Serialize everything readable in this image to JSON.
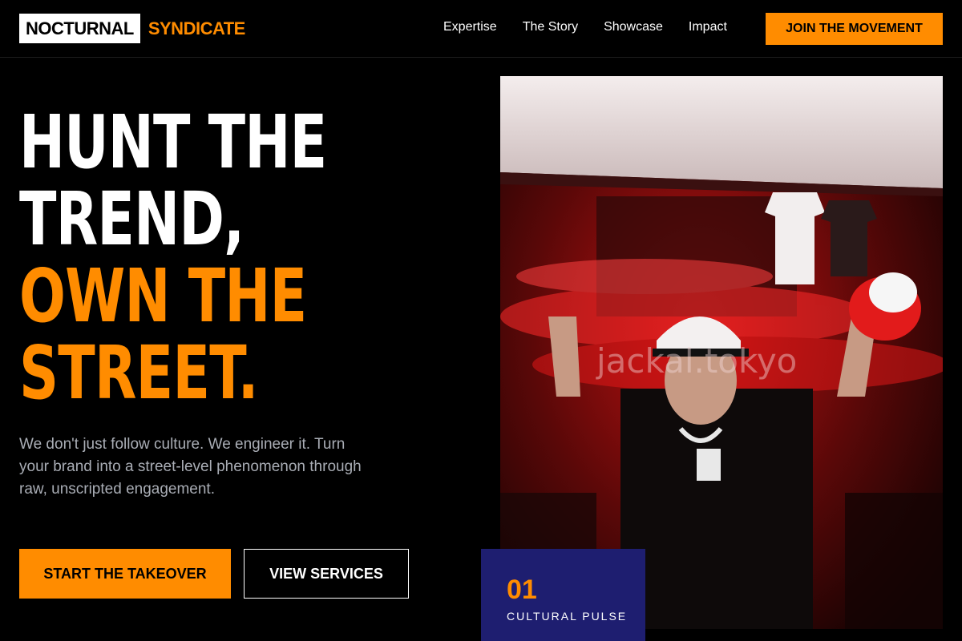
{
  "header": {
    "logo_primary": "NOCTURNAL",
    "logo_accent": "SYNDICATE",
    "nav": [
      {
        "label": "Expertise"
      },
      {
        "label": "The Story"
      },
      {
        "label": "Showcase"
      },
      {
        "label": "Impact"
      }
    ],
    "cta_label": "JOIN THE MOVEMENT"
  },
  "hero": {
    "headline": {
      "line1": "HUNT THE",
      "line2": "TREND,",
      "line3": "OWN THE",
      "line4": "STREET."
    },
    "lead": "We don't just follow culture. We engineer it. Turn your brand into a street-level phenomenon through raw, unscripted engagement.",
    "primary_button": "START THE TAKEOVER",
    "secondary_button": "VIEW SERVICES",
    "image_watermark": "jackal.tokyo",
    "stat": {
      "number": "01",
      "label": "CULTURAL PULSE"
    }
  },
  "colors": {
    "accent": "#ff8c00",
    "background": "#000000",
    "stat_card": "#1e1e70",
    "muted_text": "#a9adb5"
  }
}
